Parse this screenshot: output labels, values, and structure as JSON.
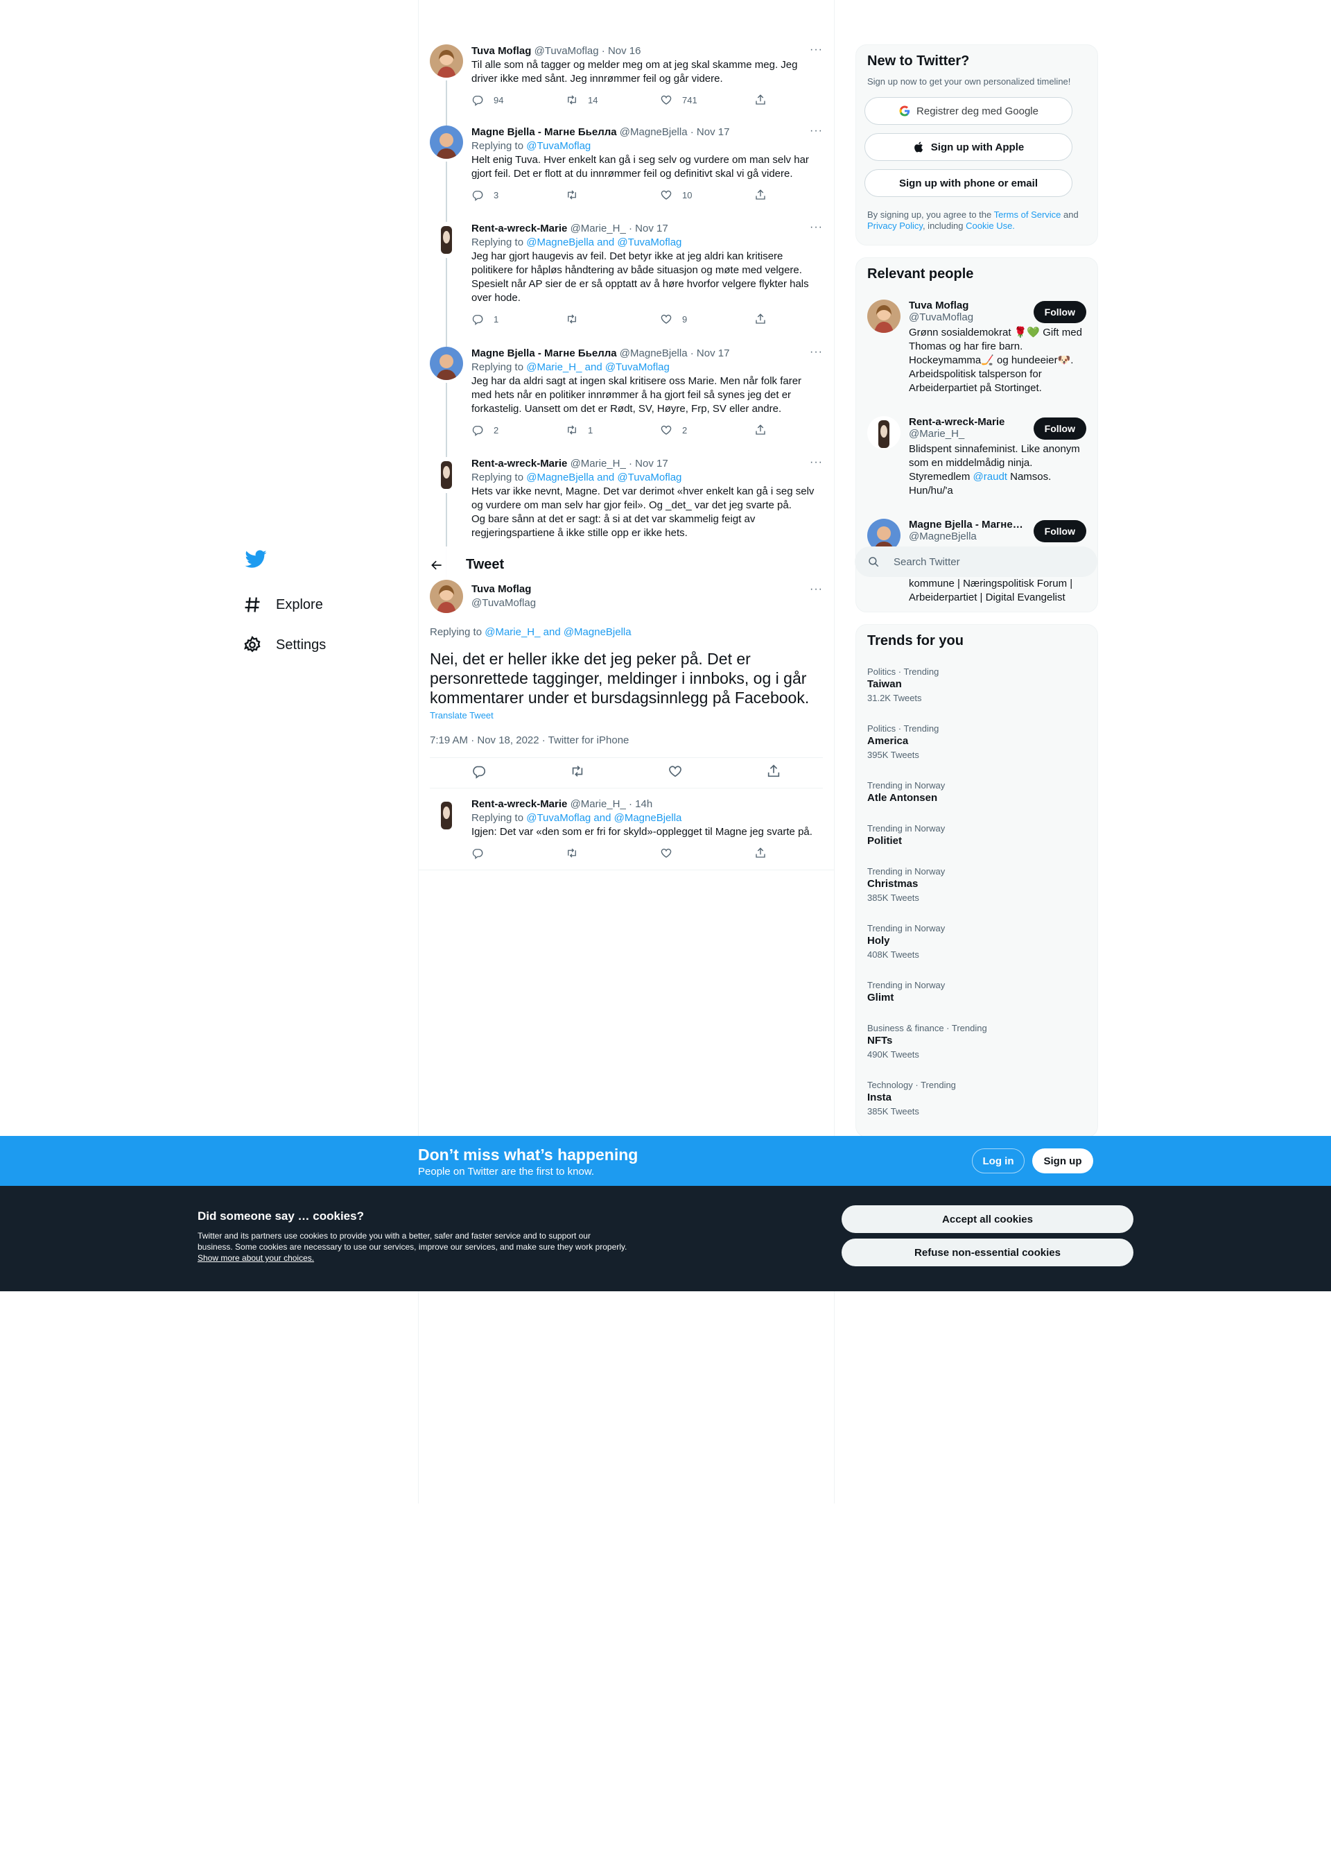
{
  "nav": {
    "items": [
      {
        "label": "Explore",
        "icon": "hashtag-icon"
      },
      {
        "label": "Settings",
        "icon": "gear-icon"
      }
    ]
  },
  "thread": [
    {
      "name": "Tuva Moflag",
      "handle": "@TuvaMoflag",
      "date": "Nov 16",
      "replying": "",
      "text": "Til alle som nå tagger og melder meg om at jeg skal skamme meg. Jeg driver ikke med sånt. Jeg innrømmer feil og går videre.",
      "replies": "94",
      "retweets": "14",
      "likes": "741"
    },
    {
      "name": "Magne Bjella - Магне Бьелла",
      "handle": "@MagneBjella",
      "date": "Nov 17",
      "replying_prefix": "Replying to ",
      "replying": "@TuvaMoflag",
      "text": "Helt enig Tuva. Hver enkelt kan gå i seg selv og vurdere om man selv har gjort feil. Det er flott at du innrømmer feil og definitivt skal vi gå videre.",
      "replies": "3",
      "retweets": "",
      "likes": "10"
    },
    {
      "name": "Rent-a-wreck-Marie",
      "handle": "@Marie_H_",
      "date": "Nov 17",
      "replying_prefix": "Replying to ",
      "replying": "@MagneBjella and @TuvaMoflag",
      "text": "Jeg har gjort haugevis av feil. Det betyr ikke at jeg aldri kan kritisere politikere for håpløs håndtering av både situasjon og møte med velgere. Spesielt når AP sier de er så opptatt av å høre hvorfor velgere flykter hals over hode.",
      "replies": "1",
      "retweets": "",
      "likes": "9"
    },
    {
      "name": "Magne Bjella - Магне Бьелла",
      "handle": "@MagneBjella",
      "date": "Nov 17",
      "replying_prefix": "Replying to ",
      "replying": "@Marie_H_ and @TuvaMoflag",
      "text": "Jeg har da aldri sagt at ingen skal kritisere oss Marie. Men når folk farer med hets når en politiker innrømmer å ha gjort feil så synes jeg det er forkastelig. Uansett om det er Rødt, SV, Høyre, Frp, SV eller andre.",
      "replies": "2",
      "retweets": "1",
      "likes": "2"
    },
    {
      "name": "Rent-a-wreck-Marie",
      "handle": "@Marie_H_",
      "date": "Nov 17",
      "replying_prefix": "Replying to ",
      "replying": "@MagneBjella and @TuvaMoflag",
      "text": "Hets var ikke nevnt, Magne. Det var derimot «hver enkelt kan gå i seg selv og vurdere om man selv har gjor feil». Og _det_ var det jeg svarte på.\nOg bare sånn at det er sagt: å si at det var skammelig feigt av regjeringspartiene å ikke stille opp er ikke hets.",
      "replies": "",
      "retweets": "",
      "likes": ""
    }
  ],
  "header": {
    "title": "Tweet"
  },
  "focus": {
    "name": "Tuva Moflag",
    "handle": "@TuvaMoflag",
    "replying_prefix": "Replying to ",
    "replying": "@Marie_H_ and @MagneBjella",
    "text": "Nei, det er heller ikke det jeg peker på. Det er personrettede tagginger, meldinger i innboks, og i går kommentarer under et bursdagsinnlegg på Facebook.",
    "translate": "Translate Tweet",
    "meta": "7:19 AM · Nov 18, 2022 · Twitter for iPhone"
  },
  "reply": {
    "name": "Rent-a-wreck-Marie",
    "handle": "@Marie_H_",
    "date": "14h",
    "replying_prefix": "Replying to ",
    "replying": "@TuvaMoflag and @MagneBjella",
    "text": "Igjen: Det var «den som er fri for skyld»-opplegget til Magne jeg svarte på."
  },
  "new_to_twitter": {
    "title": "New to Twitter?",
    "subtitle": "Sign up now to get your own personalized timeline!",
    "google": "Registrer deg med Google",
    "apple": "Sign up with Apple",
    "phone": "Sign up with phone or email",
    "fine_1": "By signing up, you agree to the ",
    "terms": "Terms of Service",
    "fine_2": " and ",
    "privacy": "Privacy Policy",
    "fine_3": ", including ",
    "cookie": "Cookie Use."
  },
  "relevant": {
    "title": "Relevant people",
    "follow": "Follow",
    "people": [
      {
        "name": "Tuva Moflag",
        "handle": "@TuvaMoflag",
        "bio": "Grønn sosialdemokrat 🌹💚 Gift med Thomas og har fire barn. Hockeymamma🏒 og hundeeier🐶. Arbeidspolitisk talsperson for Arbeiderpartiet på Stortinget."
      },
      {
        "name": "Rent-a-wreck-Marie",
        "handle": "@Marie_H_",
        "bio_1": "Blidspent sinnafeminist. Like anonym som en middelmådig ninja. Styremedlem ",
        "bio_link": "@raudt",
        "bio_2": " Namsos. Hun/hu/'a"
      },
      {
        "name": "Magne Bjella - Магне ...",
        "handle": "@MagneBjella",
        "bio": "kommune | Næringspolitisk Forum | Arbeiderpartiet | Digital Evangelist"
      }
    ]
  },
  "search": {
    "placeholder": "Search Twitter"
  },
  "trends": {
    "title": "Trends for you",
    "items": [
      {
        "context": "Politics · Trending",
        "name": "Taiwan",
        "count": "31.2K Tweets"
      },
      {
        "context": "Politics · Trending",
        "name": "America",
        "count": "395K Tweets"
      },
      {
        "context": "Trending in Norway",
        "name": "Atle Antonsen",
        "count": ""
      },
      {
        "context": "Trending in Norway",
        "name": "Politiet",
        "count": ""
      },
      {
        "context": "Trending in Norway",
        "name": "Christmas",
        "count": "385K Tweets"
      },
      {
        "context": "Trending in Norway",
        "name": "Holy",
        "count": "408K Tweets"
      },
      {
        "context": "Trending in Norway",
        "name": "Glimt",
        "count": ""
      },
      {
        "context": "Business & finance · Trending",
        "name": "NFTs",
        "count": "490K Tweets"
      },
      {
        "context": "Technology · Trending",
        "name": "Insta",
        "count": "385K Tweets"
      }
    ]
  },
  "signup_bar": {
    "headline": "Don’t miss what’s happening",
    "sub": "People on Twitter are the first to know.",
    "login": "Log in",
    "signup": "Sign up"
  },
  "cookies": {
    "title": "Did someone say … cookies?",
    "text": "Twitter and its partners use cookies to provide you with a better, safer and faster service and to support our business. Some cookies are necessary to use our services, improve our services, and make sure they work properly. ",
    "link": "Show more about your choices.",
    "accept": "Accept all cookies",
    "refuse": "Refuse non-essential cookies"
  },
  "colors": {
    "accent": "#1d9bf0",
    "text": "#0f1419",
    "muted": "#536471",
    "cookie_bg": "#15202b"
  }
}
